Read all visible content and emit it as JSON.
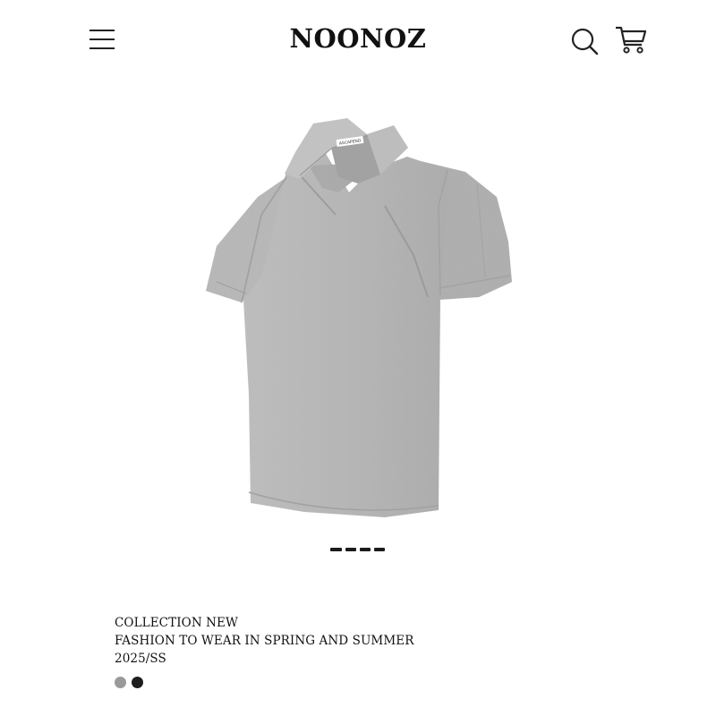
{
  "header": {
    "brand": "NOONOZ",
    "menu_icon": "hamburger-menu-icon",
    "search_icon": "search-icon",
    "cart_icon": "shopping-cart-icon"
  },
  "product": {
    "image_alt": "grey-polo-shirt-image",
    "label_text": "ASCAPEND",
    "gallery": {
      "count": 4,
      "active_index": 0
    }
  },
  "details": {
    "line1": "COLLECTION NEW",
    "line2": "FASHION TO WEAR IN SPRING AND SUMMER",
    "line3": "2025/SS"
  },
  "colors": [
    {
      "name": "grey",
      "hex": "#9a9a9a"
    },
    {
      "name": "black",
      "hex": "#1e1e1e"
    }
  ]
}
